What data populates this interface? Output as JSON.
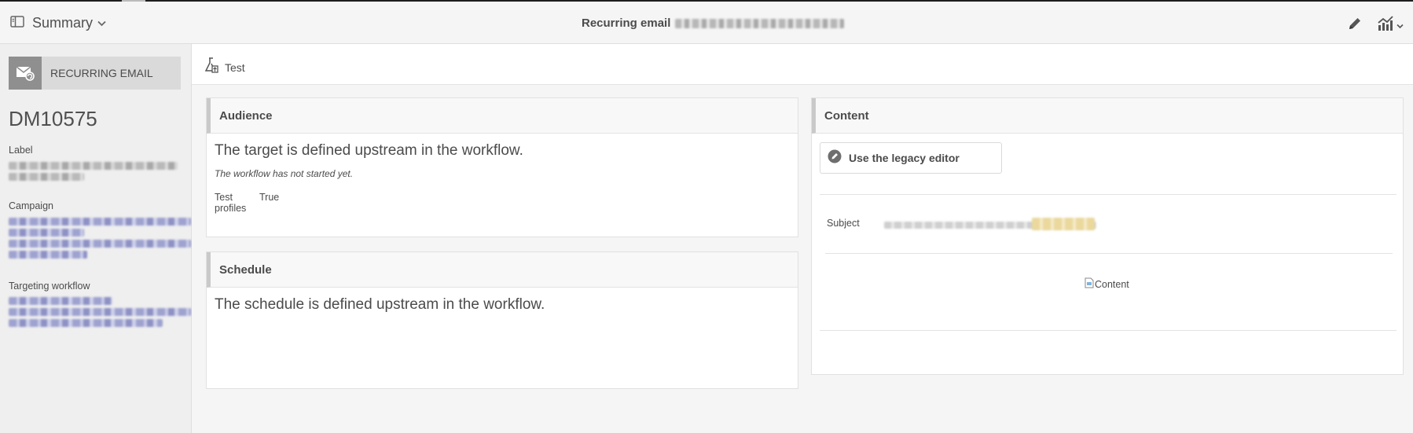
{
  "header": {
    "menu_label": "Summary",
    "page_title": "Recurring email"
  },
  "sidebar": {
    "type_label": "RECURRING EMAIL",
    "delivery_code": "DM10575",
    "label_title": "Label",
    "campaign_title": "Campaign",
    "workflow_title": "Targeting workflow"
  },
  "toolbar": {
    "test_label": "Test"
  },
  "audience": {
    "title": "Audience",
    "target_text": "The target is defined upstream in the workflow.",
    "workflow_note": "The workflow has not started yet.",
    "test_profiles_label": "Test profiles",
    "test_profiles_value": "True"
  },
  "schedule": {
    "title": "Schedule",
    "text": "The schedule is defined upstream in the workflow."
  },
  "content": {
    "title": "Content",
    "legacy_label": "Use the legacy editor",
    "subject_label": "Subject",
    "image_alt": "Content"
  }
}
